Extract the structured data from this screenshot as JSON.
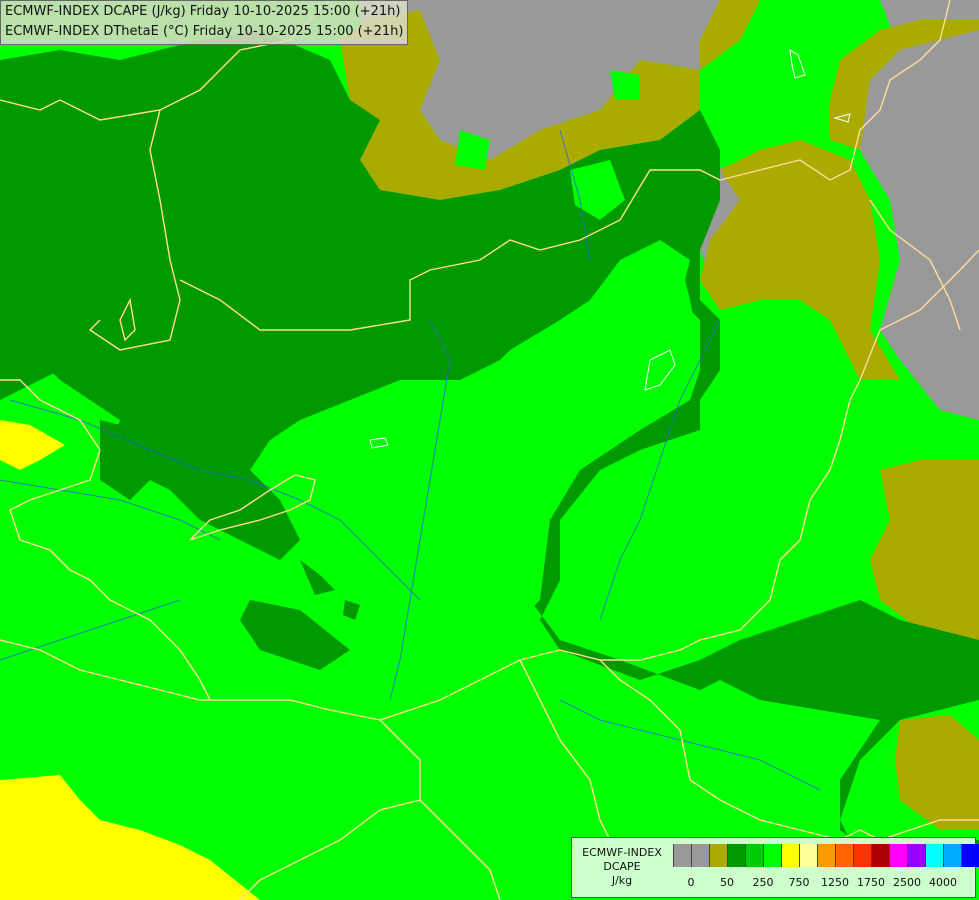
{
  "title": {
    "line1": "ECMWF-INDEX DCAPE (J/kg) Friday 10-10-2025 15:00 (+21h)",
    "line2": "ECMWF-INDEX DThetaE (°C) Friday 10-10-2025 15:00 (+21h)"
  },
  "legend": {
    "title_line1": "ECMWF-INDEX",
    "title_line2": "DCAPE",
    "unit": "J/kg",
    "colors": [
      "#999999",
      "#999999",
      "#aaaa00",
      "#009900",
      "#00cc00",
      "#00ff00",
      "#ffff00",
      "#ffff99",
      "#ff9900",
      "#ff6600",
      "#ff3300",
      "#aa0000",
      "#ff00ff",
      "#9900ff",
      "#00ffff",
      "#00aaff",
      "#0000ff",
      "#000099"
    ],
    "tick_labels": [
      "0",
      "50",
      "250",
      "750",
      "1250",
      "1750",
      "2500",
      "4000"
    ]
  },
  "colors": {
    "grey": "#999999",
    "olive": "#aaaa00",
    "dark_green": "#009900",
    "green": "#00ff00",
    "yellow": "#ffff00",
    "border": "#ffdd99",
    "river": "#3366cc"
  }
}
